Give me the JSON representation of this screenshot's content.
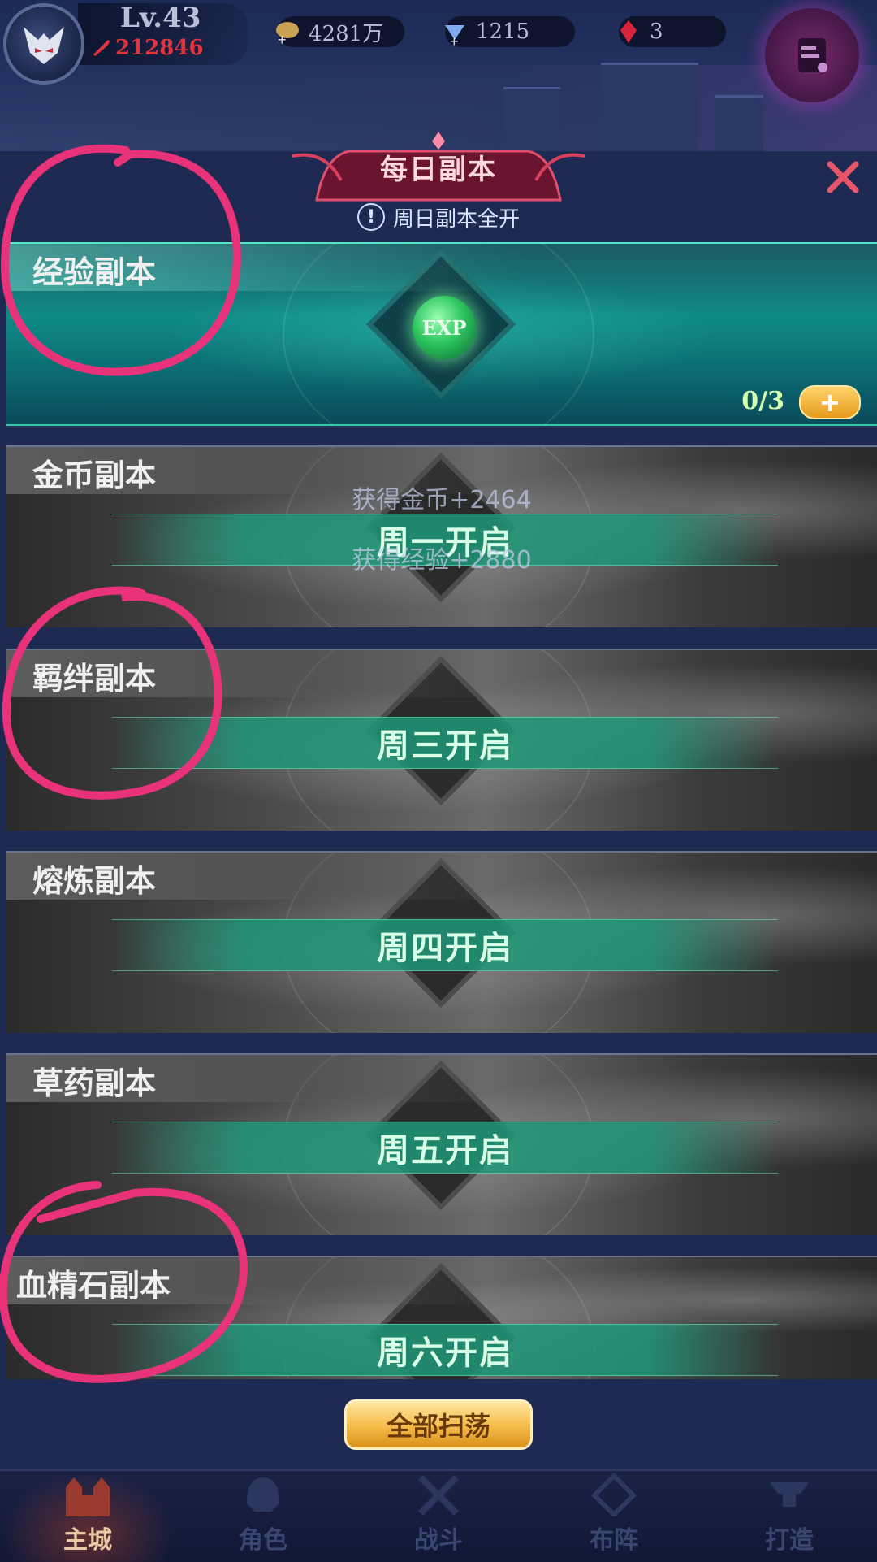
{
  "player": {
    "level": "Lv.43",
    "power": "212846"
  },
  "resources": {
    "gold": "4281万",
    "diamonds": "1215",
    "gems": "3"
  },
  "dialog": {
    "title": "每日副本",
    "notice": "周日副本全开"
  },
  "dungeons": [
    {
      "name": "经验副本",
      "status": "active",
      "count": "0/3"
    },
    {
      "name": "金币副本",
      "status": "locked",
      "open_text": "周一开启",
      "rewards": [
        "获得金币+2464",
        "获得经验+2880"
      ]
    },
    {
      "name": "羁绊副本",
      "status": "locked",
      "open_text": "周三开启"
    },
    {
      "name": "熔炼副本",
      "status": "locked",
      "open_text": "周四开启"
    },
    {
      "name": "草药副本",
      "status": "locked",
      "open_text": "周五开启"
    },
    {
      "name": "血精石副本",
      "status": "locked",
      "open_text": "周六开启"
    }
  ],
  "exp_orb_label": "EXP",
  "sweep_all_label": "全部扫荡",
  "nav": [
    {
      "label": "主城",
      "active": true
    },
    {
      "label": "角色",
      "active": false
    },
    {
      "label": "战斗",
      "active": false
    },
    {
      "label": "布阵",
      "active": false
    },
    {
      "label": "打造",
      "active": false
    }
  ],
  "colors": {
    "accent_teal": "#0f8a86",
    "annotation_pink": "#e8337a",
    "gold_button": "#f5bb48"
  }
}
